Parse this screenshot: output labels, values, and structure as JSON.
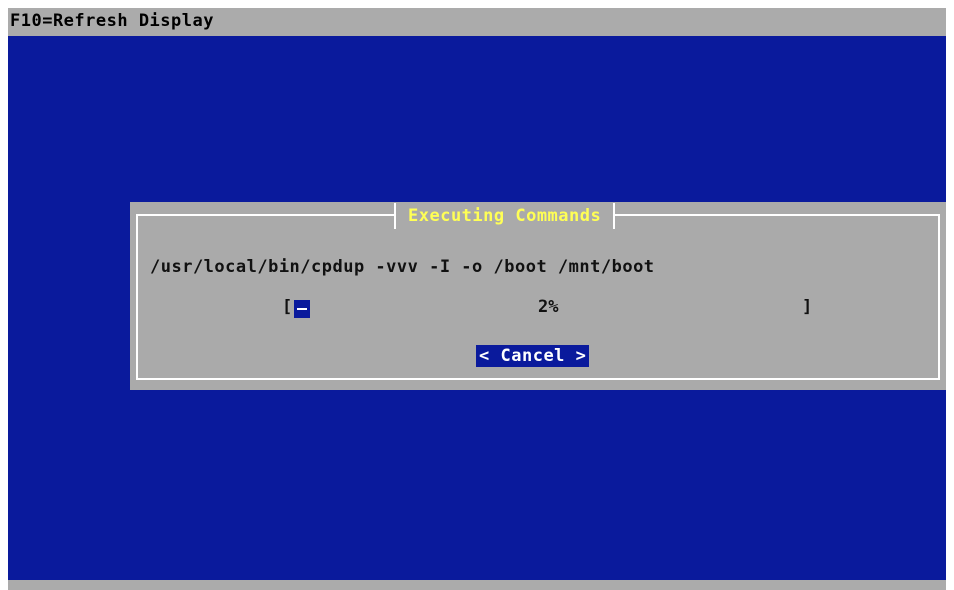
{
  "topbar": {
    "label": "F10=Refresh Display"
  },
  "dialog": {
    "title": "Executing Commands",
    "command": "/usr/local/bin/cpdup -vvv -I -o /boot /mnt/boot",
    "progress": {
      "bracket_left": "[",
      "bracket_right": "]",
      "percent_text": "2%",
      "value_fraction": 0.02
    },
    "cancel_button": {
      "left_glyph": "<",
      "label": "Cancel",
      "right_glyph": ">"
    }
  },
  "colors": {
    "background": "#0a1a9c",
    "dialog": "#aaaaaa",
    "title": "#ffff55",
    "frame": "#ffffff",
    "bars": "#ababab"
  }
}
